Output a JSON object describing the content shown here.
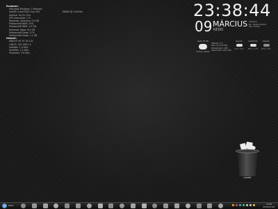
{
  "sysinfo": {
    "rows": [
      {
        "label": "Rendszer:",
        "value": "",
        "head": true
      },
      {
        "label": "Microsoft Windows 7 Ultimate",
        "value": ""
      },
      {
        "label": "Intel(R) Core(TM)2 Duo CPU",
        "value": "E6850 @ 3.00GHz"
      },
      {
        "label": "Uptime: 0d 2h 15m",
        "value": ""
      },
      {
        "label": "CPU használat: 1 %",
        "value": ""
      },
      {
        "label": "Rendszer memória: 3,0 GB",
        "value": ""
      },
      {
        "label": "Felhasznált RAM: 33%",
        "value": ""
      },
      {
        "label": "Felhasznált RAM: 1,0 GB",
        "value": ""
      },
      {
        "label": "Rendszer Swap: 6,0 GB",
        "value": ""
      },
      {
        "label": "Felhasznált Swap: 17%",
        "value": ""
      },
      {
        "label": "Felhasznált Swap: 1,1 GB",
        "value": ""
      },
      {
        "label": "Hálózat:",
        "value": "",
        "head": true
      },
      {
        "label": "WAN IP: 87.97.35.141",
        "value": ""
      },
      {
        "label": "LAN IP: 192.168.1.2",
        "value": ""
      },
      {
        "label": "Letöltés: 1,4 kb/s",
        "value": ""
      },
      {
        "label": "Feltöltés: 1,2 kb/s",
        "value": ""
      },
      {
        "label": "Összesen: 2,6 kb/s",
        "value": ""
      }
    ]
  },
  "clock": {
    "time": "23:38:44",
    "day": "09",
    "month": "MÁRCIUS",
    "weekday": "KEDD",
    "place_lines": [
      "Időjárás",
      "Bp. Pesterzsébet",
      "Ma: Felhős"
    ]
  },
  "weather": {
    "columns": [
      {
        "label": "Kedd 23:38",
        "temp": "Erősen felhős"
      },
      {
        "label": "Szerda",
        "temp": "4°C / 1°C"
      },
      {
        "label": "Csütörtök",
        "temp": "6°C / -1°C"
      },
      {
        "label": "Péntek",
        "temp": "8°C / 1°C"
      }
    ],
    "details": [
      "Hőérzet: 2°C",
      "Szél: 13 km/h ÉNy",
      "Páratartalom: 69%",
      "Légnyomás: 1014 hPa"
    ]
  },
  "recycle_bin": {
    "label": "Lomtár"
  },
  "taskbar": {
    "start_label": "Start",
    "icons": [
      "start-orb-icon",
      "folder-icon",
      "browser-icon",
      "mail-icon",
      "media-icon",
      "settings-icon",
      "explorer-icon",
      "player-icon",
      "app-icon",
      "chat-icon",
      "paint-icon",
      "game-icon",
      "network-icon",
      "tool-icon",
      "star-icon",
      "weather-icon",
      "calendar-icon",
      "terminal-icon",
      "download-icon",
      "camera-icon"
    ],
    "clock_time": "23:38",
    "clock_date": "2010.03.09."
  }
}
